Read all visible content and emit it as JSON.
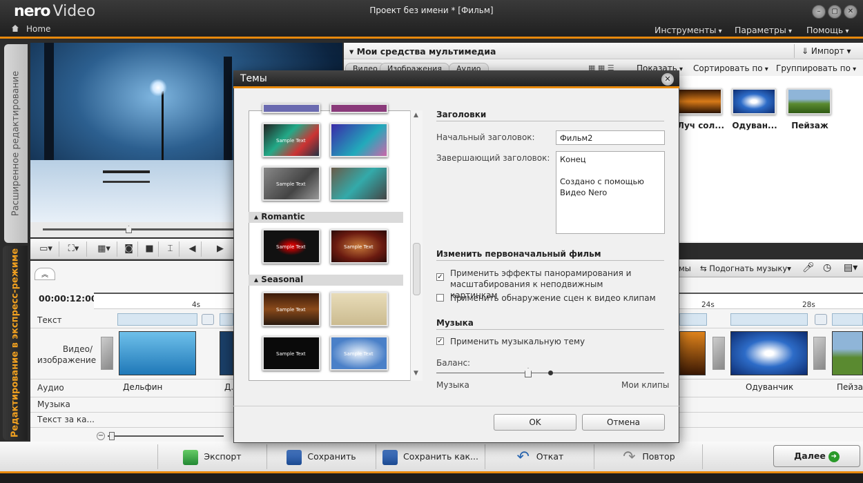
{
  "app": {
    "brand": "nero",
    "product": "Video",
    "window_title": "Проект без имени * [Фильм]",
    "home": "Home"
  },
  "menu": {
    "tools": "Инструменты",
    "params": "Параметры",
    "help": "Помощь"
  },
  "side_tabs": {
    "advanced": "Расширенное редактирование",
    "express": "Редактирование в экспресс-режиме"
  },
  "media": {
    "title": "Мои средства мультимедиа",
    "import": "Импорт",
    "tabs": [
      "Видео",
      "Изображения",
      "Аудио"
    ],
    "show": "Показать",
    "sort": "Сортировать по",
    "group": "Группировать по",
    "items": [
      "Луч сол...",
      "Одуван...",
      "Пейзаж"
    ]
  },
  "timeline": {
    "timecode": "00:00:12:00",
    "ruler": [
      "4s",
      "24s",
      "28s"
    ],
    "tracks": {
      "text": "Текст",
      "video": "Видео/\nизображение",
      "audio": "Аудио",
      "music": "Музыка",
      "voice": "Текст за ка..."
    },
    "clips": [
      "Дельфин",
      "Д...",
      "Одуванчик",
      "Пейзаж"
    ],
    "tools": {
      "themes": "емы",
      "fit_music": "Подогнать музыку"
    }
  },
  "bottom": {
    "export": "Экспорт",
    "save": "Сохранить",
    "save_as": "Сохранить как...",
    "undo": "Откат",
    "redo": "Повтор",
    "next": "Далее"
  },
  "dialog": {
    "title": "Темы",
    "categories": [
      "Romantic",
      "Seasonal"
    ],
    "sample_text": "Sample Text",
    "titles_section": "Заголовки",
    "start_title_label": "Начальный заголовок:",
    "start_title_value": "Фильм2",
    "end_title_label": "Завершающий заголовок:",
    "end_title_value": "Конец\n\nСоздано с помощью\nВидео Nero",
    "change_section": "Изменить первоначальный фильм",
    "opt_pan": "Применить эффекты панорамирования и масштабирования к неподвижным картинкам",
    "opt_pan_checked": true,
    "opt_scene": "Применить обнаружение сцен к видео клипам",
    "opt_scene_checked": false,
    "music_section": "Музыка",
    "opt_music": "Применить музыкальную тему",
    "opt_music_checked": true,
    "balance_label": "Баланс:",
    "balance_left": "Музыка",
    "balance_right": "Мои клипы",
    "balance_value": 0.5,
    "ok": "OK",
    "cancel": "Отмена"
  },
  "colors": {
    "accent": "#e8890c"
  }
}
